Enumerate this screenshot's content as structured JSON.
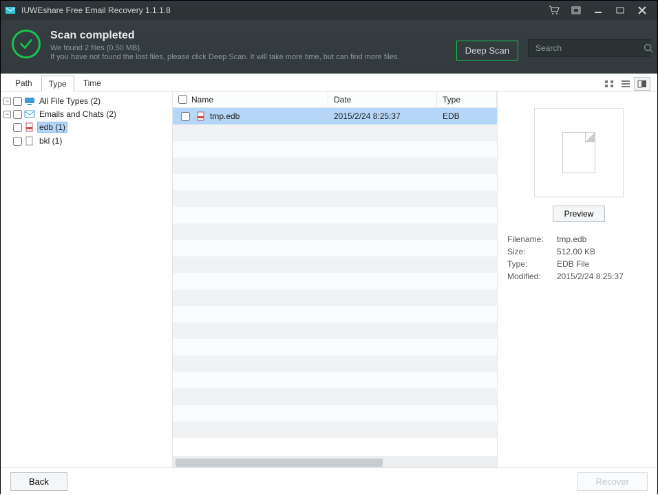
{
  "app_title": "IUWEshare Free Email Recovery 1.1.1.8",
  "status": {
    "title": "Scan completed",
    "found": "We found 2 files (0.50 MB).",
    "hint": "If you have not found the lost files, please click Deep Scan. It will take more time, but can find more files."
  },
  "buttons": {
    "deep_scan": "Deep Scan",
    "back": "Back",
    "recover": "Recover",
    "preview": "Preview"
  },
  "search": {
    "placeholder": "Search"
  },
  "tabs": {
    "path": "Path",
    "type": "Type",
    "time": "Time",
    "active": "type"
  },
  "view_modes": {
    "grid": "grid",
    "list": "list",
    "detail": "detail",
    "active": "detail"
  },
  "tree": {
    "root": {
      "label": "All File Types (2)"
    },
    "emails": {
      "label": "Emails and Chats (2)"
    },
    "edb": {
      "label": "edb (1)",
      "selected": true
    },
    "bkl": {
      "label": "bkl (1)"
    }
  },
  "columns": {
    "name": "Name",
    "date": "Date",
    "type": "Type"
  },
  "files": [
    {
      "name": "tmp.edb",
      "date": "2015/2/24 8:25:37",
      "type": "EDB",
      "selected": true
    }
  ],
  "empty_rows": 19,
  "preview": {
    "filename_label": "Filename:",
    "size_label": "Size:",
    "type_label": "Type:",
    "modified_label": "Modified:",
    "filename": "tmp.edb",
    "size": "512.00 KB",
    "type": "EDB File",
    "modified": "2015/2/24 8:25:37"
  }
}
